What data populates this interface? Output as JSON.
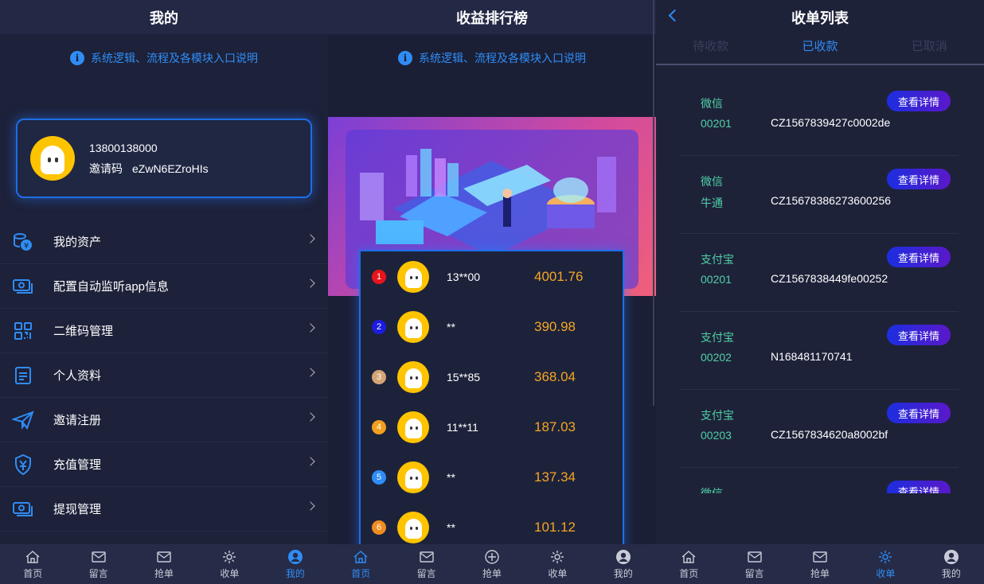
{
  "profile_panel": {
    "title": "我的",
    "info": "系统逻辑、流程及各模块入口说明",
    "phone": "13800138000",
    "invite_label": "邀请码",
    "invite_code": "eZwN6EZroHIs",
    "menu": [
      {
        "label": "我的资产",
        "icon": "coins-icon"
      },
      {
        "label": "配置自动监听app信息",
        "icon": "cash-icon"
      },
      {
        "label": "二维码管理",
        "icon": "qrcode-icon"
      },
      {
        "label": "个人资料",
        "icon": "document-icon"
      },
      {
        "label": "邀请注册",
        "icon": "paper-plane-icon"
      },
      {
        "label": "充值管理",
        "icon": "yen-shield-icon"
      },
      {
        "label": "提现管理",
        "icon": "cash-icon"
      }
    ],
    "tabs": [
      "首页",
      "留言",
      "抢单",
      "收单",
      "我的"
    ],
    "active_tab": "我的"
  },
  "ranking_panel": {
    "title": "收益排行榜",
    "info": "系统逻辑、流程及各模块入口说明",
    "ranks": [
      {
        "num": "1",
        "name": "13**00",
        "value": "4001.76",
        "color": "#e8141c"
      },
      {
        "num": "2",
        "name": "**",
        "value": "390.98",
        "color": "#1c1ce0"
      },
      {
        "num": "3",
        "name": "15**85",
        "value": "368.04",
        "color": "#d4a574"
      },
      {
        "num": "4",
        "name": "11**11",
        "value": "187.03",
        "color": "#f0a01e"
      },
      {
        "num": "5",
        "name": "**",
        "value": "137.34",
        "color": "#2f8df5"
      },
      {
        "num": "6",
        "name": "**",
        "value": "101.12",
        "color": "#f08c1e"
      }
    ],
    "tabs": [
      "首页",
      "留言",
      "抢单",
      "收单",
      "我的"
    ],
    "active_tab": "首页"
  },
  "orders_panel": {
    "title": "收单列表",
    "subtabs": [
      "待收款",
      "已收款",
      "已取消"
    ],
    "active_subtab": "已收款",
    "button_label": "查看详情",
    "orders": [
      {
        "type": "微信",
        "code": "00201",
        "no": "CZ1567839427c0002de"
      },
      {
        "type": "微信",
        "code": "牛通",
        "no": "CZ15678386273600256"
      },
      {
        "type": "支付宝",
        "code": "00201",
        "no": "CZ1567838449fe00252"
      },
      {
        "type": "支付宝",
        "code": "00202",
        "no": "N168481170741"
      },
      {
        "type": "支付宝",
        "code": "00203",
        "no": "CZ1567834620a8002bf"
      },
      {
        "type": "微信",
        "code": "",
        "no": ""
      }
    ],
    "tabs": [
      "首页",
      "留言",
      "抢单",
      "收单",
      "我的"
    ],
    "active_tab": "收单"
  },
  "colors": {
    "accent": "#2f8df5",
    "gold": "#f5a623",
    "green": "#4fd1a5"
  }
}
